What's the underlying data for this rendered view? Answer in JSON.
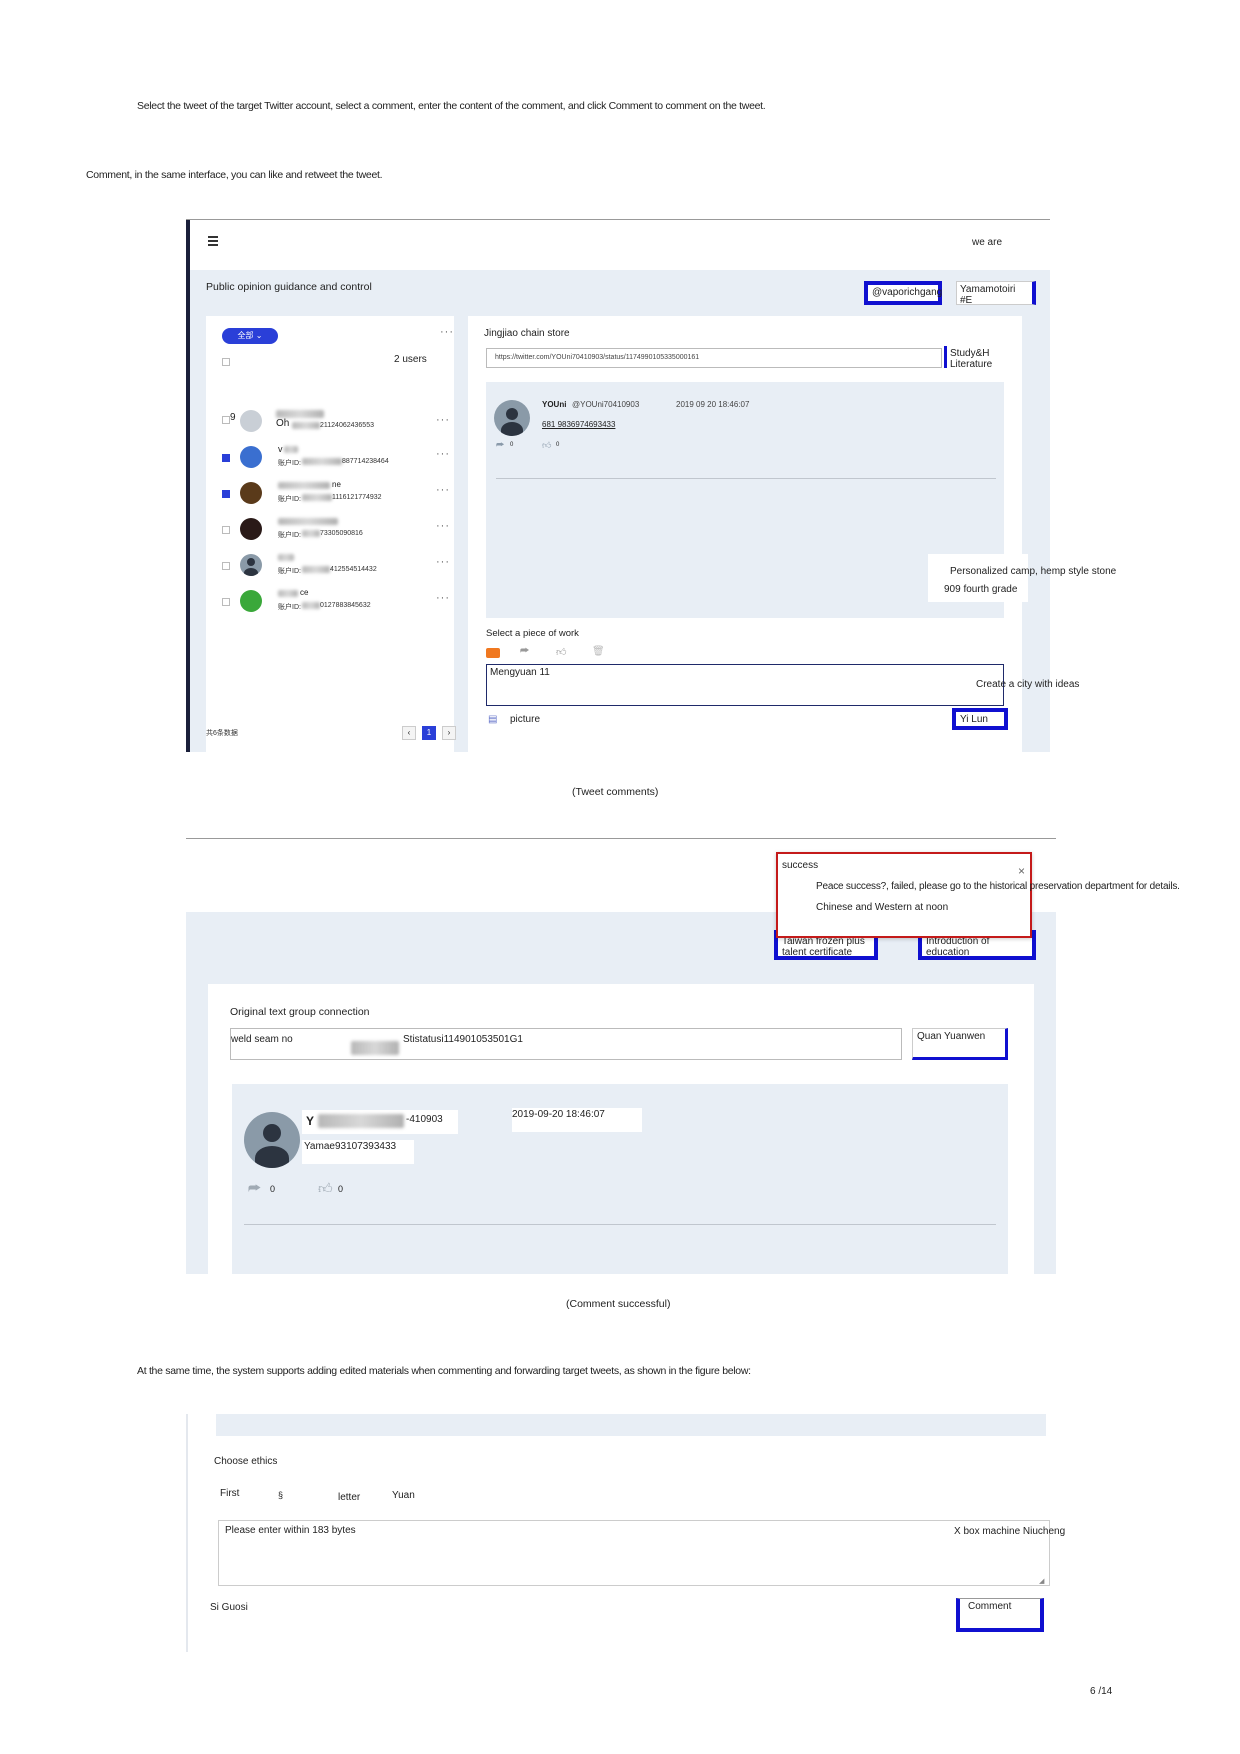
{
  "intro": {
    "line1": "Select the tweet of the target Twitter account, select a comment, enter the content of the comment, and click Comment to comment on the tweet.",
    "line2": "Comment, in the same interface, you can like and retweet the tweet."
  },
  "screen1": {
    "header_right": "we are",
    "toolbar_title": "Public opinion guidance and control",
    "btn_account": "@vaporichgang",
    "btn_yamamoto": "Yamamotoiri #E",
    "filter_label": "全部",
    "users_count": "2 users",
    "accounts": [
      {
        "name_line": "9",
        "id_line": "Oh",
        "tail": "21124062436553",
        "checked": false,
        "avatar": "#c9cfd6"
      },
      {
        "name_line": "v",
        "id_line": "账户ID:",
        "tail": "887714238464",
        "checked": true,
        "avatar": "#3a6fd0"
      },
      {
        "name_line": "ne",
        "id_line": "账户ID:",
        "tail": "1116121774932",
        "checked": true,
        "avatar": "#5a3a1a"
      },
      {
        "name_line": "",
        "id_line": "账户ID:",
        "tail": "73305090816",
        "checked": false,
        "avatar": "#2a1a18"
      },
      {
        "name_line": "",
        "id_line": "账户ID:",
        "tail": "412554514432",
        "checked": false,
        "avatar": "#2c3440"
      },
      {
        "name_line": "ce",
        "id_line": "账户ID:",
        "tail": "0127883845632",
        "checked": false,
        "avatar": "#3aa83a"
      }
    ],
    "footer_total": "共6条数据",
    "page_current": "1",
    "store_label": "Jingjiao chain store",
    "url_value": "https://twitter.com/YOUni70410903/status/1174990105335000161",
    "study_btn": "Study&H Literature",
    "tweet_author": "YOUni",
    "tweet_handle": "@YOUni70410903",
    "tweet_time": "2019 09 20 18:46:07",
    "tweet_text": "681 9836974693433",
    "tweet_retweets": "0",
    "tweet_likes": "0",
    "overlay1": "Personalized camp, hemp style stone",
    "overlay2": "909 fourth grade",
    "select_work": "Select a piece of work",
    "comment_value": "Mengyuan 11",
    "overlay3": "Create a city with ideas",
    "picture_label": "picture",
    "submit_btn": "Yi Lun"
  },
  "caption1": "(Tweet comments)",
  "screen2": {
    "popup_title": "success",
    "popup_line1": "Peace success?, failed, please go to the historical preservation department for details.",
    "popup_line2": "Chinese and Western at noon",
    "btn_taiwan": "Taiwan frozen plus talent certificate",
    "btn_intro": "Introduction of education",
    "group_label": "Original text group connection",
    "input_left": "weld seam no",
    "input_right": "Stistatusi114901053501G1",
    "quan_btn": "Quan Yuanwen",
    "tweet_author_initial": "Y",
    "tweet_handle_tail": "-410903",
    "tweet_time": "2019-09-20 18:46:07",
    "tweet_text": "Yamae93107393433",
    "tweet_retweets": "0",
    "tweet_likes": "0"
  },
  "caption2": "(Comment successful)",
  "para3": "At the same time, the system supports adding edited materials when commenting and forwarding target tweets, as shown in the figure below:",
  "screen3": {
    "choose_label": "Choose ethics",
    "tab_first": "First",
    "tab_mark": "§",
    "tab_letter": "letter",
    "tab_yuan": "Yuan",
    "textarea_placeholder": "Please enter within 183 bytes",
    "xbox_label": "X box machine Niucheng",
    "sig_label": "Si Guosi",
    "comment_btn": "Comment"
  },
  "page_number": "6 /14"
}
